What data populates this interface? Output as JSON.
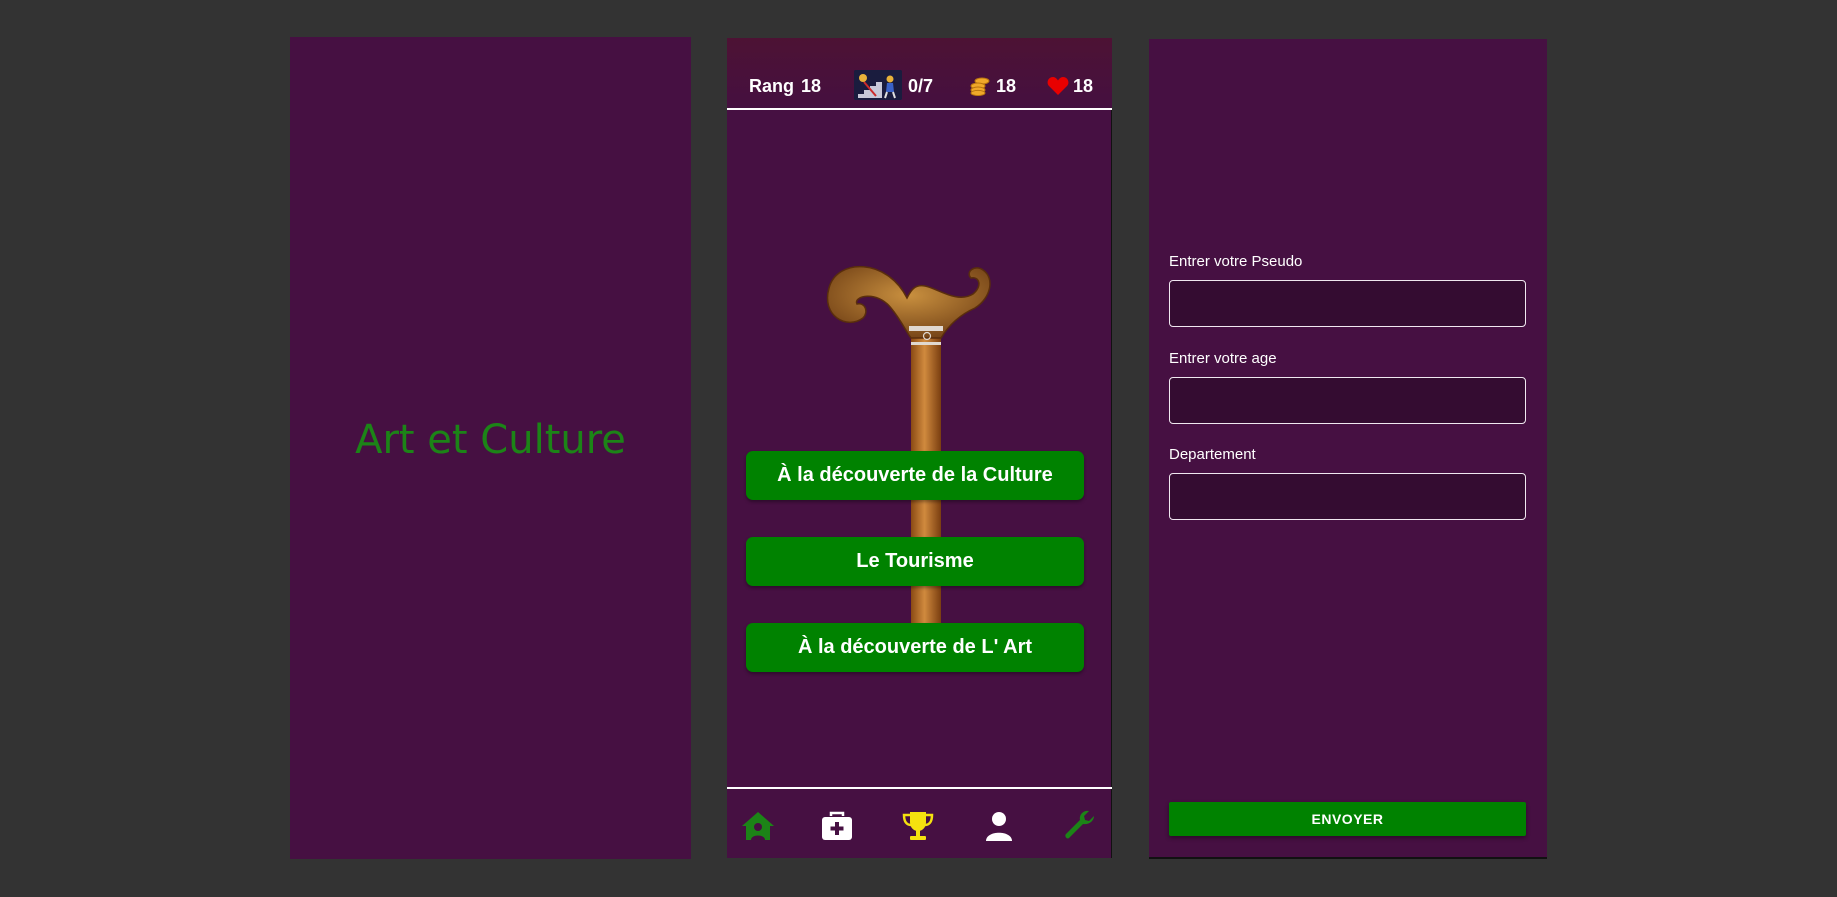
{
  "splash": {
    "title": "Art et Culture"
  },
  "header": {
    "rank_label": "Rang",
    "rank_value": "18",
    "progress": "0/7",
    "coins": "18",
    "lives": "18"
  },
  "menu": {
    "buttons": [
      "À la découverte de la Culture",
      "Le Tourisme",
      "À la découverte de L' Art"
    ]
  },
  "nav": {
    "icons": [
      "home-icon",
      "medical-kit-icon",
      "trophy-icon",
      "user-icon",
      "wrench-icon"
    ],
    "colors": {
      "home": "#1c8417",
      "medical": "#ffffff",
      "trophy": "#f5e20f",
      "user": "#ffffff",
      "wrench": "#1c8417"
    }
  },
  "form": {
    "pseudo_label": "Entrer votre Pseudo",
    "pseudo_value": "",
    "age_label": "Entrer votre age",
    "age_value": "",
    "departement_label": "Departement",
    "departement_value": "",
    "submit_label": "ENVOYER"
  },
  "colors": {
    "background": "#333333",
    "screen": "#461042",
    "accent_green": "#008200",
    "splash_text": "#1c8417"
  }
}
